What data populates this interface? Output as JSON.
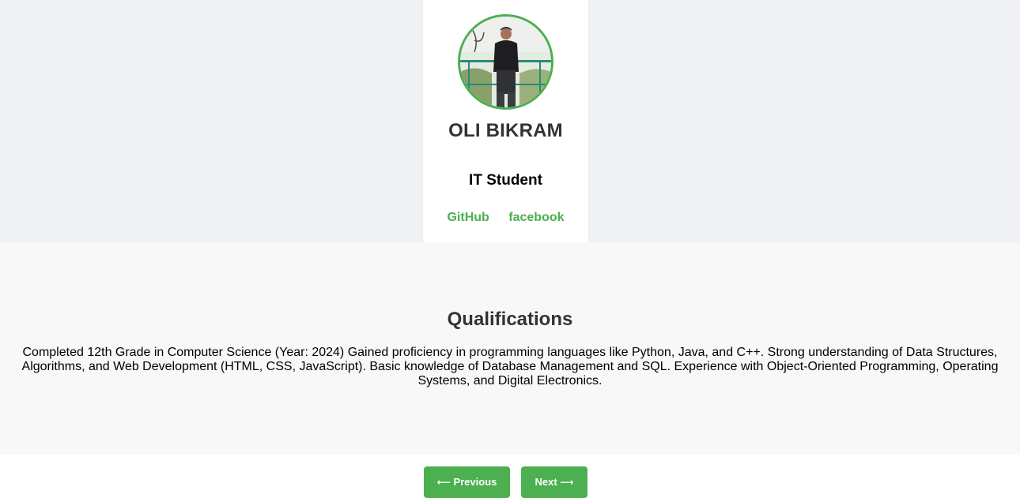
{
  "profile": {
    "name": "OLI BIKRAM",
    "role": "IT Student",
    "links": [
      {
        "label": "GitHub"
      },
      {
        "label": "facebook"
      }
    ]
  },
  "qualifications": {
    "heading": "Qualifications",
    "text": "Completed 12th Grade in Computer Science (Year: 2024) Gained proficiency in programming languages like Python, Java, and C++. Strong understanding of Data Structures, Algorithms, and Web Development (HTML, CSS, JavaScript). Basic knowledge of Database Management and SQL. Experience with Object-Oriented Programming, Operating Systems, and Digital Electronics."
  },
  "navigation": {
    "previous_label": "Previous",
    "previous_arrow": "⟵",
    "next_label": "Next",
    "next_arrow": "⟶"
  },
  "colors": {
    "accent": "#4caf50",
    "hero_background": "#f0f1f5",
    "section_background": "#f8f8f8"
  },
  "icons": {
    "previous": "arrow-left-icon",
    "next": "arrow-right-icon"
  }
}
